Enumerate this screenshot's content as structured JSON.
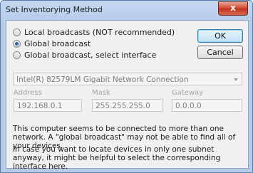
{
  "window": {
    "title": "Set Inventorying Method",
    "close_label": "x"
  },
  "options": [
    {
      "label": "Local broadcasts (NOT recommended)",
      "selected": false
    },
    {
      "label": "Global broadcast",
      "selected": true
    },
    {
      "label": "Global broadcast, select interface",
      "selected": false
    }
  ],
  "buttons": {
    "ok": "OK",
    "cancel": "Cancel"
  },
  "interface": {
    "selected": "Intel(R) 82579LM Gigabit Network Connection"
  },
  "labels": {
    "address": "Address",
    "mask": "Mask",
    "gateway": "Gateway"
  },
  "values": {
    "address": "192.168.0.1",
    "mask": "255.255.255.0",
    "gateway": "0.0.0.0"
  },
  "notes": {
    "p1": "This computer seems to be connected to more than one network. A \"global broadcast\" may not be able to find all of your devices.",
    "p2": "In case you want to locate devices in only one subnet anyway, it might be helpful to select the corresponding interface here."
  }
}
